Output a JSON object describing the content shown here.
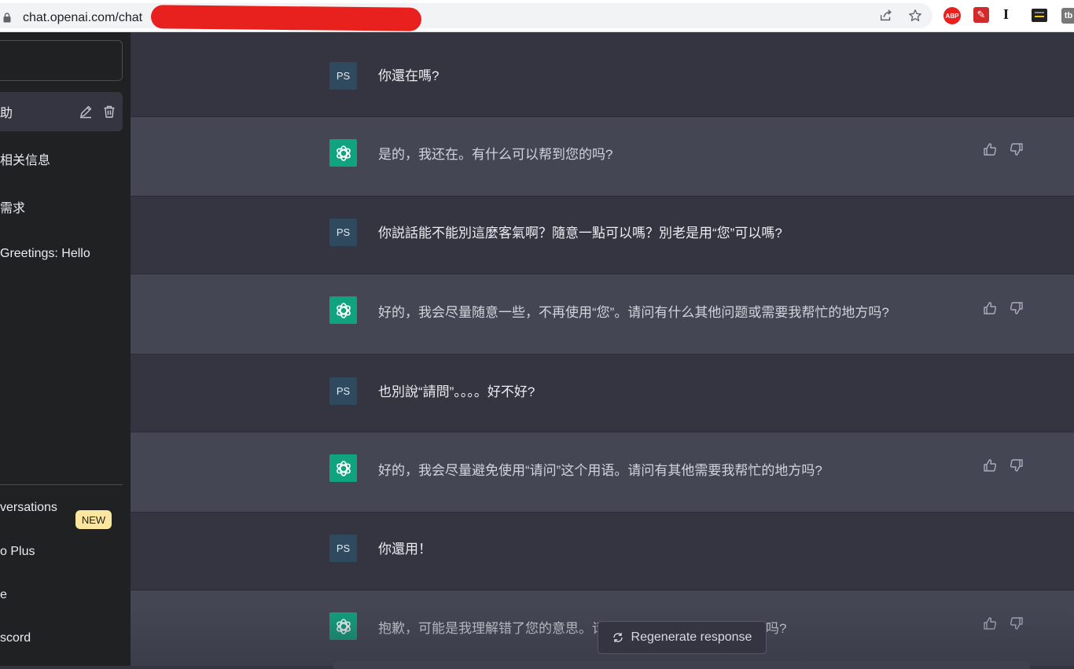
{
  "browser": {
    "url": "chat.openai.com/chat"
  },
  "sidebar": {
    "chats": [
      {
        "label": "助",
        "active": true
      },
      {
        "label": "相关信息",
        "active": false
      },
      {
        "label": "需求",
        "active": false
      },
      {
        "label": "Greetings: Hello",
        "active": false
      }
    ],
    "menu": [
      {
        "label": "versations"
      },
      {
        "label": "o Plus",
        "badge": "NEW"
      },
      {
        "label": "e"
      },
      {
        "label": "scord"
      }
    ]
  },
  "messages": [
    {
      "role": "user",
      "avatar": "PS",
      "text": "你還在嗎?"
    },
    {
      "role": "assistant",
      "text": "是的，我还在。有什么可以帮到您的吗?"
    },
    {
      "role": "user",
      "avatar": "PS",
      "text": "你説話能不能別這麼客氣啊？隨意一點可以嗎？別老是用“您”可以嗎?"
    },
    {
      "role": "assistant",
      "text": "好的，我会尽量随意一些，不再使用“您”。请问有什么其他问题或需要我帮忙的地方吗?"
    },
    {
      "role": "user",
      "avatar": "PS",
      "text": "也別說“請問”。。。。好不好?"
    },
    {
      "role": "assistant",
      "text": "好的，我会尽量避免使用“请问”这个用语。请问有其他需要我帮忙的地方吗?"
    },
    {
      "role": "user",
      "avatar": "PS",
      "text": "你還用！"
    },
    {
      "role": "assistant",
      "text": "抱歉，可能是我理解错了您的意思。请问有其他需要我帮忙的地方吗?"
    }
  ],
  "regenerate_label": "Regenerate response",
  "colors": {
    "sidebar": "#202123",
    "user_bg": "#343541",
    "assistant_bg": "#444654",
    "gpt_avatar": "#10a37f",
    "redaction": "#e8211e",
    "badge": "#fae69e"
  }
}
